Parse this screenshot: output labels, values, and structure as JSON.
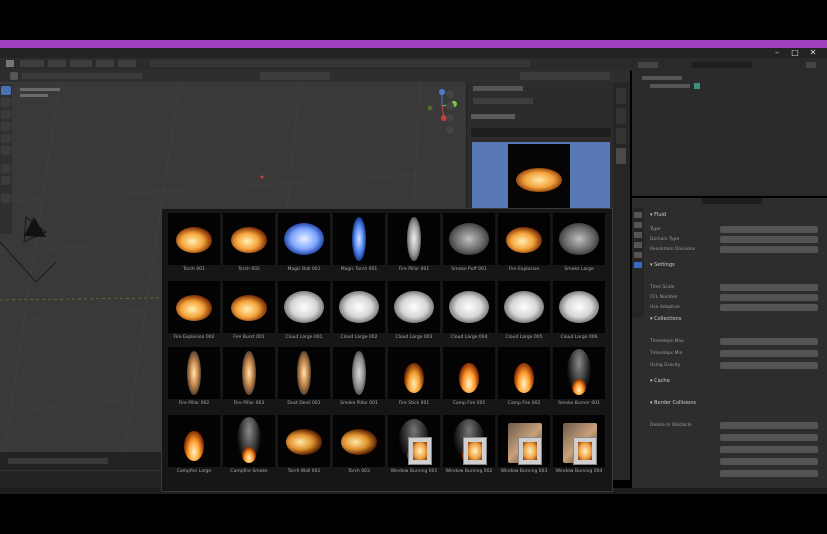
{
  "app": {
    "title": "",
    "colors": {
      "accent_bar": "#a13ec0",
      "selection": "#4772b3",
      "thumb_bg": "#5879b4"
    }
  },
  "window_controls": [
    {
      "name": "minimize-icon",
      "glyph": "–"
    },
    {
      "name": "maximize-icon",
      "glyph": "□"
    },
    {
      "name": "close-icon",
      "glyph": "✕"
    }
  ],
  "asset_panel": {
    "header": "",
    "preview_label": ""
  },
  "assets": [
    {
      "label": "Torch 001",
      "kind": "fire"
    },
    {
      "label": "Torch 002",
      "kind": "fire"
    },
    {
      "label": "Magic Ball 001",
      "kind": "blue-cloud"
    },
    {
      "label": "Magic Torch 001",
      "kind": "blue-flame"
    },
    {
      "label": "Fire Pillar 001",
      "kind": "white-pillar"
    },
    {
      "label": "Smoke Puff 001",
      "kind": "smoke"
    },
    {
      "label": "Fire Explosion",
      "kind": "fire"
    },
    {
      "label": "Smoke Large",
      "kind": "smoke"
    },
    {
      "label": "Fire Explosion 002",
      "kind": "fire"
    },
    {
      "label": "Fire Burst 001",
      "kind": "fire"
    },
    {
      "label": "Cloud Large 001",
      "kind": "white-cloud"
    },
    {
      "label": "Cloud Large 002",
      "kind": "white-cloud"
    },
    {
      "label": "Cloud Large 003",
      "kind": "white-cloud"
    },
    {
      "label": "Cloud Large 004",
      "kind": "white-cloud"
    },
    {
      "label": "Cloud Large 005",
      "kind": "white-cloud"
    },
    {
      "label": "Cloud Large 006",
      "kind": "white-cloud"
    },
    {
      "label": "Fire Pillar 002",
      "kind": "flame-pillar"
    },
    {
      "label": "Fire Pillar 003",
      "kind": "flame-pillar"
    },
    {
      "label": "Dust Devil 001",
      "kind": "flame-pillar"
    },
    {
      "label": "Smoke Pillar 001",
      "kind": "smoke-pillar"
    },
    {
      "label": "Fire Stick 001",
      "kind": "stick-fire"
    },
    {
      "label": "Camp Fire 001",
      "kind": "camp-fire"
    },
    {
      "label": "Camp Fire 002",
      "kind": "camp-fire"
    },
    {
      "label": "Smoke Burner 001",
      "kind": "smoke-fire"
    },
    {
      "label": "Campfire Large",
      "kind": "camp-fire"
    },
    {
      "label": "Campfire Smoke",
      "kind": "smoke-fire"
    },
    {
      "label": "Torch Wall 001",
      "kind": "wall-torch"
    },
    {
      "label": "Torch 003",
      "kind": "wall-torch"
    },
    {
      "label": "Window Burning 001",
      "kind": "window"
    },
    {
      "label": "Window Burning 002",
      "kind": "window"
    },
    {
      "label": "Window Burning 003",
      "kind": "window-frame"
    },
    {
      "label": "Window Burning 004",
      "kind": "window-frame"
    }
  ],
  "properties": {
    "sections": [
      "Fluid",
      "Settings",
      "Collections",
      "Cache",
      "Border Collisions"
    ],
    "rows": [
      "Type",
      "Domain Type",
      "Resolution Divisions",
      "Time Scale",
      "CFL Number",
      "Use Adaptive",
      "Timesteps Max",
      "Timesteps Min",
      "Using Gravity",
      "Delete In Obstacle"
    ]
  }
}
